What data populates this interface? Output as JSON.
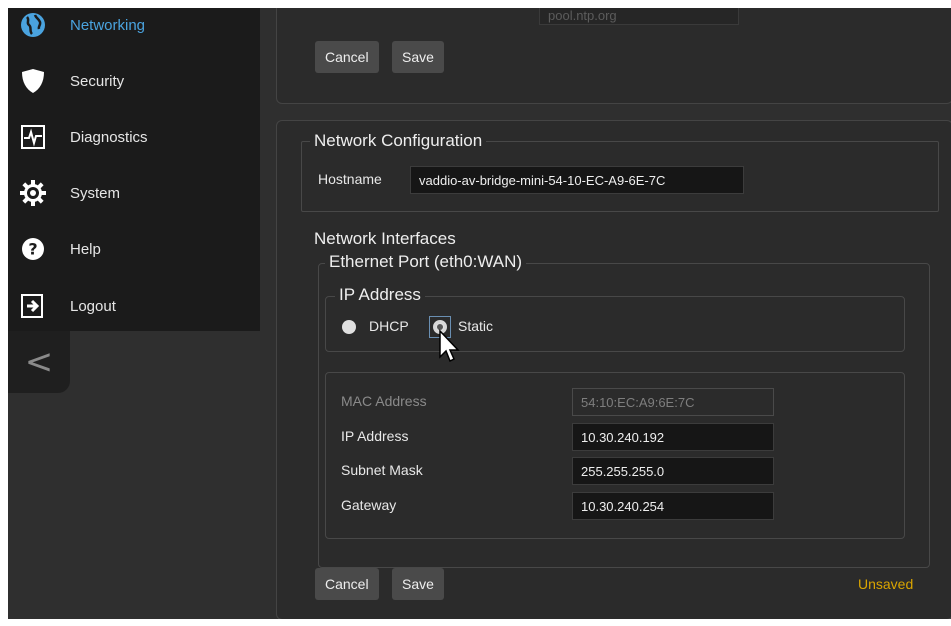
{
  "sidebar": {
    "items": [
      {
        "label": "Networking",
        "icon": "globe-icon",
        "active": true
      },
      {
        "label": "Security",
        "icon": "shield-icon",
        "active": false
      },
      {
        "label": "Diagnostics",
        "icon": "pulse-icon",
        "active": false
      },
      {
        "label": "System",
        "icon": "gear-icon",
        "active": false
      },
      {
        "label": "Help",
        "icon": "question-icon",
        "active": false
      },
      {
        "label": "Logout",
        "icon": "logout-icon",
        "active": false
      }
    ],
    "collapse_glyph": "<"
  },
  "top_panel": {
    "ntp_server_value": "pool.ntp.org",
    "cancel_label": "Cancel",
    "save_label": "Save"
  },
  "network_config": {
    "title": "Network Configuration",
    "hostname_label": "Hostname",
    "hostname_value": "vaddio-av-bridge-mini-54-10-EC-A9-6E-7C",
    "interfaces_title": "Network Interfaces",
    "port_title": "Ethernet Port (eth0:WAN)",
    "ip_address_title": "IP Address",
    "mode_options": [
      {
        "label": "DHCP",
        "selected": false
      },
      {
        "label": "Static",
        "selected": true
      }
    ],
    "fields": {
      "mac_label": "MAC Address",
      "mac_value": "54:10:EC:A9:6E:7C",
      "ip_label": "IP Address",
      "ip_value": "10.30.240.192",
      "subnet_label": "Subnet Mask",
      "subnet_value": "255.255.255.0",
      "gateway_label": "Gateway",
      "gateway_value": "10.30.240.254"
    },
    "cancel_label": "Cancel",
    "save_label": "Save",
    "status": "Unsaved"
  },
  "colors": {
    "accent": "#4aa3df",
    "unsaved": "#d9a400",
    "background": "#2f2f2f",
    "sidebar": "#1b1b1b"
  }
}
